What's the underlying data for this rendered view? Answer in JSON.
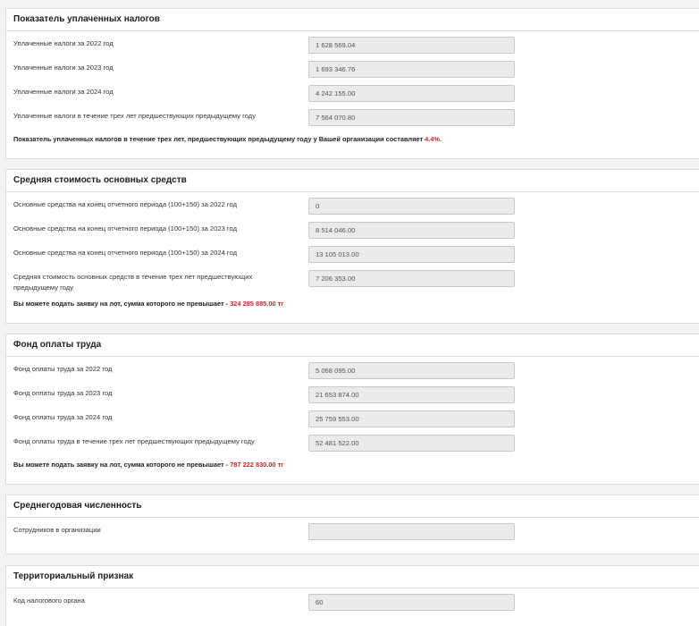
{
  "sections": [
    {
      "title": "Показатель уплаченных налогов",
      "rows": [
        {
          "label": "Уплаченные налоги за 2022 год",
          "value": "1 628 569.04"
        },
        {
          "label": "Уплаченные налоги за 2023 год",
          "value": "1 693 346.76"
        },
        {
          "label": "Уплаченные налоги за 2024 год",
          "value": "4 242 155.00"
        },
        {
          "label": "Уплаченные налоги в течение трех лет предшествующих предыдущему году",
          "value": "7 564 070.80"
        }
      ],
      "summary_text": "Показатель уплаченных налогов в течение трех лет, предшествующих предыдущему году у Вашей организации составляет",
      "summary_value": "4.4%.",
      "summary_suffix": ""
    },
    {
      "title": "Средняя стоимость основных средств",
      "rows": [
        {
          "label": "Основные средства на конец отчетного периода (100+150) за 2022 год",
          "value": "0"
        },
        {
          "label": "Основные средства на конец отчетного периода (100+150) за 2023 год",
          "value": "8 514 046.00"
        },
        {
          "label": "Основные средства на конец отчетного периода (100+150) за 2024 год",
          "value": "13 105 013.00"
        },
        {
          "label": "Средняя стоимость основных средств в течение трех лет предшествующих предыдущему году",
          "value": "7 206 353.00"
        }
      ],
      "summary_text": "Вы можете подать заявку на лот, сумма которого не превышает -",
      "summary_value": "324 285 885.00 тг",
      "summary_suffix": ""
    },
    {
      "title": "Фонд оплаты труда",
      "rows": [
        {
          "label": "Фонд оплаты труда за 2022 год",
          "value": "5 068 095.00"
        },
        {
          "label": "Фонд оплаты труда за 2023 год",
          "value": "21 653 874.00"
        },
        {
          "label": "Фонд оплаты труда за 2024 год",
          "value": "25 759 553.00"
        },
        {
          "label": "Фонд оплаты труда в течение трех лет предшествующих предыдущему году",
          "value": "52 481 522.00"
        }
      ],
      "summary_text": "Вы можете подать заявку на лот, сумма которого не превышает -",
      "summary_value": "787 222 830.00 тг",
      "summary_suffix": ""
    },
    {
      "title": "Среднегодовая численность",
      "rows": [
        {
          "label": "Сотрудников в организации",
          "value": ""
        }
      ]
    },
    {
      "title": "Территориальный признак",
      "rows": [
        {
          "label": "Код налогового органа",
          "value": "60"
        }
      ]
    }
  ]
}
